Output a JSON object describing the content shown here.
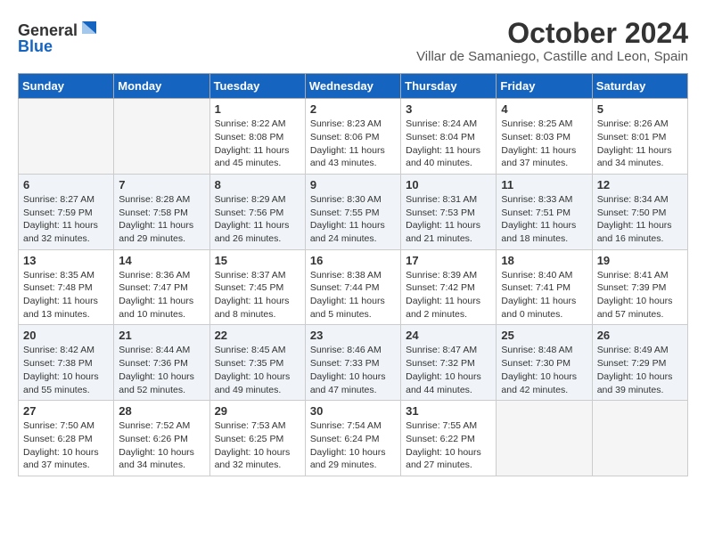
{
  "header": {
    "logo_line1": "General",
    "logo_line2": "Blue",
    "month": "October 2024",
    "location": "Villar de Samaniego, Castille and Leon, Spain"
  },
  "days_of_week": [
    "Sunday",
    "Monday",
    "Tuesday",
    "Wednesday",
    "Thursday",
    "Friday",
    "Saturday"
  ],
  "weeks": [
    [
      {
        "day": "",
        "info": ""
      },
      {
        "day": "",
        "info": ""
      },
      {
        "day": "1",
        "info": "Sunrise: 8:22 AM\nSunset: 8:08 PM\nDaylight: 11 hours and 45 minutes."
      },
      {
        "day": "2",
        "info": "Sunrise: 8:23 AM\nSunset: 8:06 PM\nDaylight: 11 hours and 43 minutes."
      },
      {
        "day": "3",
        "info": "Sunrise: 8:24 AM\nSunset: 8:04 PM\nDaylight: 11 hours and 40 minutes."
      },
      {
        "day": "4",
        "info": "Sunrise: 8:25 AM\nSunset: 8:03 PM\nDaylight: 11 hours and 37 minutes."
      },
      {
        "day": "5",
        "info": "Sunrise: 8:26 AM\nSunset: 8:01 PM\nDaylight: 11 hours and 34 minutes."
      }
    ],
    [
      {
        "day": "6",
        "info": "Sunrise: 8:27 AM\nSunset: 7:59 PM\nDaylight: 11 hours and 32 minutes."
      },
      {
        "day": "7",
        "info": "Sunrise: 8:28 AM\nSunset: 7:58 PM\nDaylight: 11 hours and 29 minutes."
      },
      {
        "day": "8",
        "info": "Sunrise: 8:29 AM\nSunset: 7:56 PM\nDaylight: 11 hours and 26 minutes."
      },
      {
        "day": "9",
        "info": "Sunrise: 8:30 AM\nSunset: 7:55 PM\nDaylight: 11 hours and 24 minutes."
      },
      {
        "day": "10",
        "info": "Sunrise: 8:31 AM\nSunset: 7:53 PM\nDaylight: 11 hours and 21 minutes."
      },
      {
        "day": "11",
        "info": "Sunrise: 8:33 AM\nSunset: 7:51 PM\nDaylight: 11 hours and 18 minutes."
      },
      {
        "day": "12",
        "info": "Sunrise: 8:34 AM\nSunset: 7:50 PM\nDaylight: 11 hours and 16 minutes."
      }
    ],
    [
      {
        "day": "13",
        "info": "Sunrise: 8:35 AM\nSunset: 7:48 PM\nDaylight: 11 hours and 13 minutes."
      },
      {
        "day": "14",
        "info": "Sunrise: 8:36 AM\nSunset: 7:47 PM\nDaylight: 11 hours and 10 minutes."
      },
      {
        "day": "15",
        "info": "Sunrise: 8:37 AM\nSunset: 7:45 PM\nDaylight: 11 hours and 8 minutes."
      },
      {
        "day": "16",
        "info": "Sunrise: 8:38 AM\nSunset: 7:44 PM\nDaylight: 11 hours and 5 minutes."
      },
      {
        "day": "17",
        "info": "Sunrise: 8:39 AM\nSunset: 7:42 PM\nDaylight: 11 hours and 2 minutes."
      },
      {
        "day": "18",
        "info": "Sunrise: 8:40 AM\nSunset: 7:41 PM\nDaylight: 11 hours and 0 minutes."
      },
      {
        "day": "19",
        "info": "Sunrise: 8:41 AM\nSunset: 7:39 PM\nDaylight: 10 hours and 57 minutes."
      }
    ],
    [
      {
        "day": "20",
        "info": "Sunrise: 8:42 AM\nSunset: 7:38 PM\nDaylight: 10 hours and 55 minutes."
      },
      {
        "day": "21",
        "info": "Sunrise: 8:44 AM\nSunset: 7:36 PM\nDaylight: 10 hours and 52 minutes."
      },
      {
        "day": "22",
        "info": "Sunrise: 8:45 AM\nSunset: 7:35 PM\nDaylight: 10 hours and 49 minutes."
      },
      {
        "day": "23",
        "info": "Sunrise: 8:46 AM\nSunset: 7:33 PM\nDaylight: 10 hours and 47 minutes."
      },
      {
        "day": "24",
        "info": "Sunrise: 8:47 AM\nSunset: 7:32 PM\nDaylight: 10 hours and 44 minutes."
      },
      {
        "day": "25",
        "info": "Sunrise: 8:48 AM\nSunset: 7:30 PM\nDaylight: 10 hours and 42 minutes."
      },
      {
        "day": "26",
        "info": "Sunrise: 8:49 AM\nSunset: 7:29 PM\nDaylight: 10 hours and 39 minutes."
      }
    ],
    [
      {
        "day": "27",
        "info": "Sunrise: 7:50 AM\nSunset: 6:28 PM\nDaylight: 10 hours and 37 minutes."
      },
      {
        "day": "28",
        "info": "Sunrise: 7:52 AM\nSunset: 6:26 PM\nDaylight: 10 hours and 34 minutes."
      },
      {
        "day": "29",
        "info": "Sunrise: 7:53 AM\nSunset: 6:25 PM\nDaylight: 10 hours and 32 minutes."
      },
      {
        "day": "30",
        "info": "Sunrise: 7:54 AM\nSunset: 6:24 PM\nDaylight: 10 hours and 29 minutes."
      },
      {
        "day": "31",
        "info": "Sunrise: 7:55 AM\nSunset: 6:22 PM\nDaylight: 10 hours and 27 minutes."
      },
      {
        "day": "",
        "info": ""
      },
      {
        "day": "",
        "info": ""
      }
    ]
  ]
}
